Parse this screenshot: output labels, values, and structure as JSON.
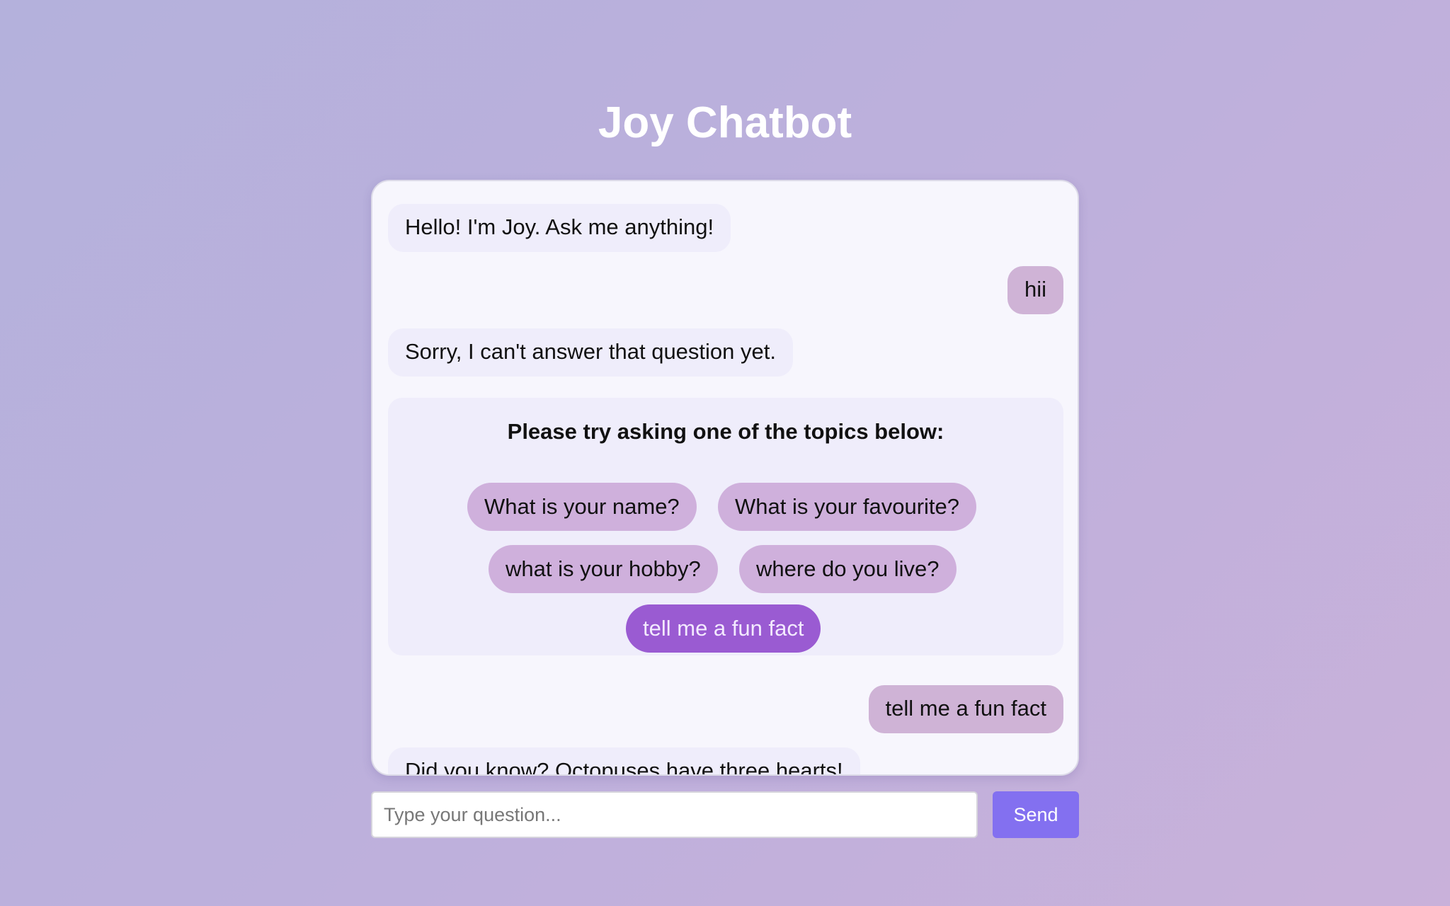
{
  "app": {
    "title": "Joy Chatbot"
  },
  "messages": [
    {
      "sender": "bot",
      "text": "Hello! I'm Joy. Ask me anything!"
    },
    {
      "sender": "user",
      "text": "hii"
    },
    {
      "sender": "bot",
      "text": "Sorry, I can't answer that question yet."
    },
    {
      "sender": "user",
      "text": "tell me a fun fact"
    },
    {
      "sender": "bot",
      "text": "Did you know? Octopuses have three hearts!"
    }
  ],
  "topics": {
    "heading": "Please try asking one of the topics below:",
    "items": [
      {
        "label": "What is your name?",
        "active": false
      },
      {
        "label": "What is your favourite?",
        "active": false
      },
      {
        "label": "what is your hobby?",
        "active": false
      },
      {
        "label": "where do you live?",
        "active": false
      },
      {
        "label": "tell me a fun fact",
        "active": true
      }
    ]
  },
  "input": {
    "value": "",
    "placeholder": "Type your question..."
  },
  "send_button": {
    "label": "Send"
  },
  "colors": {
    "user_bubble": "#cfb3d6",
    "bot_bubble": "#efedfb",
    "topic_chip": "#cfb0dc",
    "topic_chip_active": "#9a5bd2",
    "send_button": "#8370f0"
  }
}
